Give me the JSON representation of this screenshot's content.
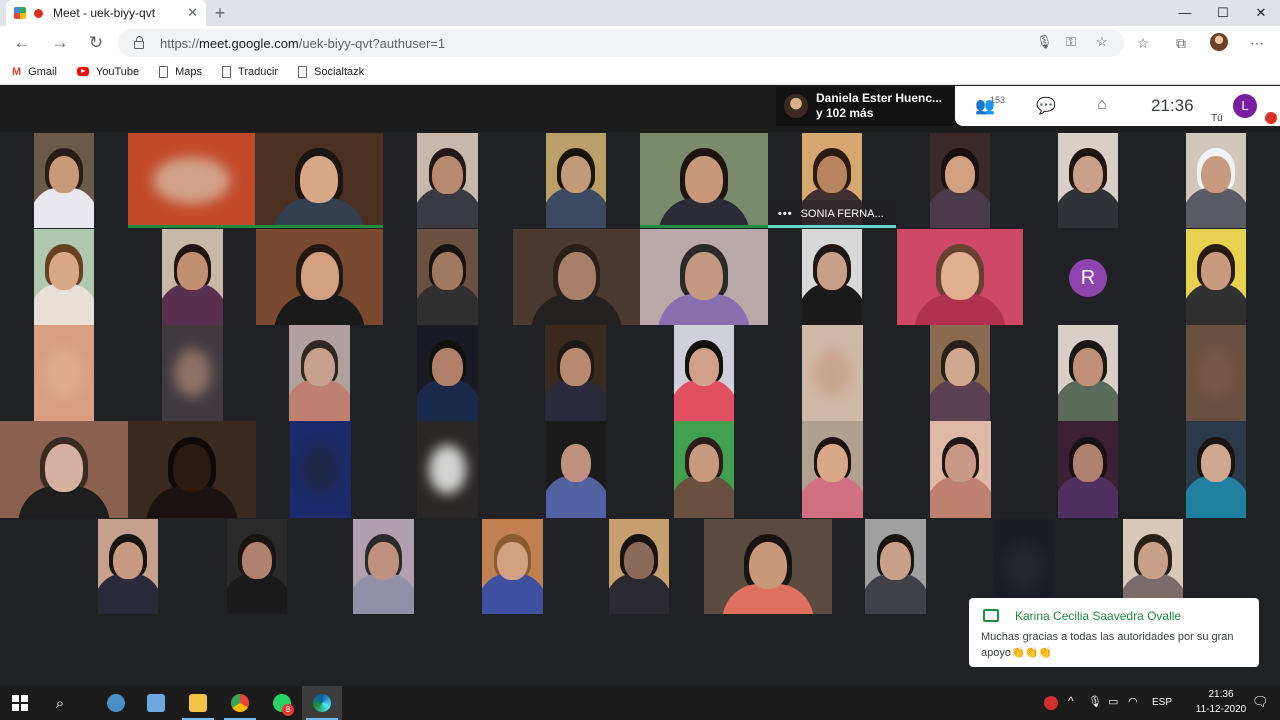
{
  "browser": {
    "tab_title": "Meet - uek-biyy-qvt",
    "url_prefix": "https://",
    "url_host": "meet.google.com",
    "url_path": "/uek-biyy-qvt?authuser=1",
    "bookmarks": [
      {
        "label": "Gmail",
        "icon": "gmail-icon"
      },
      {
        "label": "YouTube",
        "icon": "youtube-icon"
      },
      {
        "label": "Maps",
        "icon": "page-icon"
      },
      {
        "label": "Traducir",
        "icon": "page-icon"
      },
      {
        "label": "Socialtazk",
        "icon": "page-icon"
      }
    ]
  },
  "meet": {
    "presenter_line1": "Daniela Ester Huenc...",
    "presenter_line2": "y 102 más",
    "people_count": "153",
    "clock": "21:36",
    "self_initial": "L",
    "self_label": "Tú",
    "placeholder_initial": "R",
    "pinned_name": "SONIA FERNA...",
    "chat": {
      "sender": "Karina Cecilia Saavedra Ovalle",
      "message": "Muchas gracias a todas las autoridades por su gran apoyo👏👏👏"
    }
  },
  "taskbar": {
    "whatsapp_badge": "8",
    "lang": "ESP",
    "time": "21:36",
    "date": "11-12-2020"
  },
  "colors": {
    "meet_bg": "#202124",
    "speaking": "#1e8e3e",
    "pinned": "#64d8cb",
    "self_avatar": "#7b1fa2"
  }
}
